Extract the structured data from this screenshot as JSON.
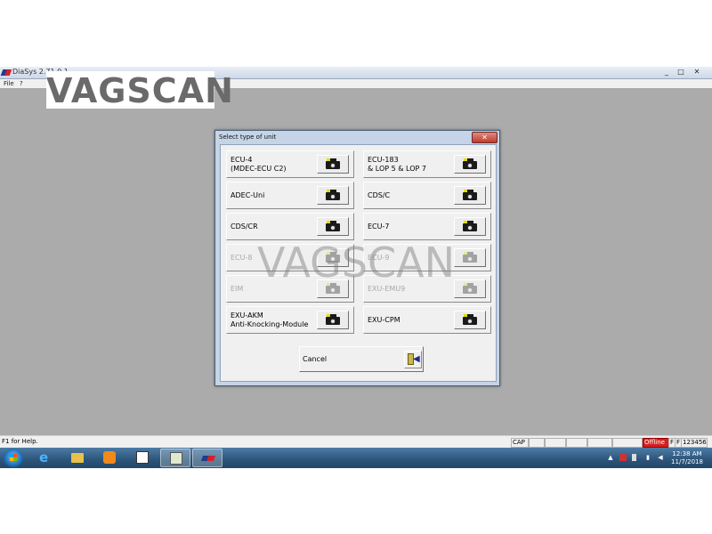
{
  "app": {
    "title": "DiaSys 2.71.0.1",
    "menu": [
      "File",
      "?"
    ],
    "window_controls": [
      "_",
      "□",
      "✕"
    ]
  },
  "watermark": {
    "logo_text": "VAGSCAN",
    "overlay_text": "VAGSCAN"
  },
  "dialog": {
    "title": "Select type of unit",
    "close_label": "✕",
    "units": [
      {
        "label": "ECU-4\n(MDEC-ECU C2)",
        "enabled": true
      },
      {
        "label": "ECU-183\n& LOP 5 & LOP 7",
        "enabled": true
      },
      {
        "label": "ADEC-Uni",
        "enabled": true
      },
      {
        "label": "CDS/C",
        "enabled": true
      },
      {
        "label": "CDS/CR",
        "enabled": true
      },
      {
        "label": "ECU-7",
        "enabled": true
      },
      {
        "label": "ECU-8",
        "enabled": false
      },
      {
        "label": "ECU-9",
        "enabled": false
      },
      {
        "label": "EIM",
        "enabled": false
      },
      {
        "label": "EXU-EMU9",
        "enabled": false
      },
      {
        "label": "EXU-AKM\nAnti-Knocking-Module",
        "enabled": true
      },
      {
        "label": "EXU-CPM",
        "enabled": true
      }
    ],
    "cancel_label": "Cancel"
  },
  "statusbar": {
    "help": "F1 for Help.",
    "cap": "CAP",
    "offline": "Offline",
    "f1": "F",
    "f2": "F",
    "serial": "123456"
  },
  "taskbar": {
    "clock_time": "12:38 AM",
    "clock_date": "11/7/2018"
  },
  "colors": {
    "offline_badge": "#d42020",
    "dialog_frame": "#c5d4e6",
    "workspace": "#ababab"
  }
}
